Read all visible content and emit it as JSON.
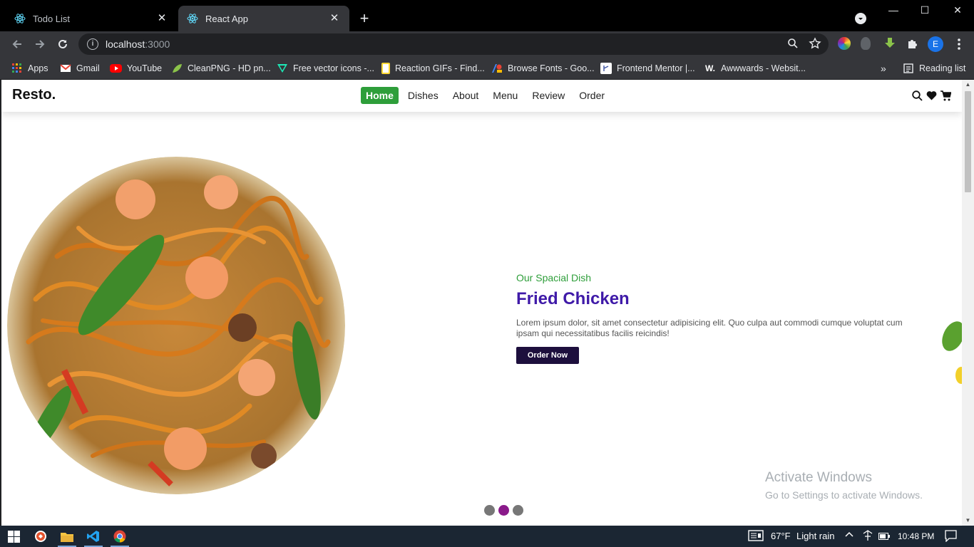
{
  "browser": {
    "tabs": [
      {
        "title": "Todo List",
        "active": false
      },
      {
        "title": "React App",
        "active": true
      }
    ],
    "url_host": "localhost",
    "url_port": ":3000",
    "profile_initial": "E",
    "bookmarks": [
      {
        "label": "Apps",
        "icon": "apps-grid-icon"
      },
      {
        "label": "Gmail",
        "icon": "gmail-icon"
      },
      {
        "label": "YouTube",
        "icon": "youtube-icon"
      },
      {
        "label": "CleanPNG - HD pn...",
        "icon": "cleanpng-icon"
      },
      {
        "label": "Free vector icons -...",
        "icon": "flaticon-icon"
      },
      {
        "label": "Reaction GIFs - Find...",
        "icon": "page-icon"
      },
      {
        "label": "Browse Fonts - Goo...",
        "icon": "google-fonts-icon"
      },
      {
        "label": "Frontend Mentor |...",
        "icon": "frontend-mentor-icon"
      },
      {
        "label": "Awwwards - Websit...",
        "icon": "awwwards-icon"
      }
    ],
    "bookmarks_overflow": "»",
    "reading_list": "Reading list"
  },
  "site": {
    "logo": "Resto.",
    "nav": [
      {
        "label": "Home",
        "active": true
      },
      {
        "label": "Dishes",
        "active": false
      },
      {
        "label": "About",
        "active": false
      },
      {
        "label": "Menu",
        "active": false
      },
      {
        "label": "Review",
        "active": false
      },
      {
        "label": "Order",
        "active": false
      }
    ],
    "hero": {
      "subtitle": "Our Spacial Dish",
      "title": "Fried Chicken",
      "description": "Lorem ipsum dolor, sit amet consectetur adipisicing elit.  Quo culpa aut commodi cumque voluptat cum ipsam qui necessitatibus facilis reicindis!",
      "button": "Order Now"
    },
    "slider": {
      "count": 3,
      "active_index": 1
    }
  },
  "watermark": {
    "line1": "Activate Windows",
    "line2": "Go to Settings to activate Windows."
  },
  "taskbar": {
    "weather": "67°F",
    "weather_text": "Light rain",
    "time": "10:48 PM"
  },
  "colors": {
    "accent_green": "#2e9e3a",
    "headline_purple": "#3f1aa8",
    "button_dark": "#1d0f3d",
    "dot_active": "#8a1a8a"
  }
}
